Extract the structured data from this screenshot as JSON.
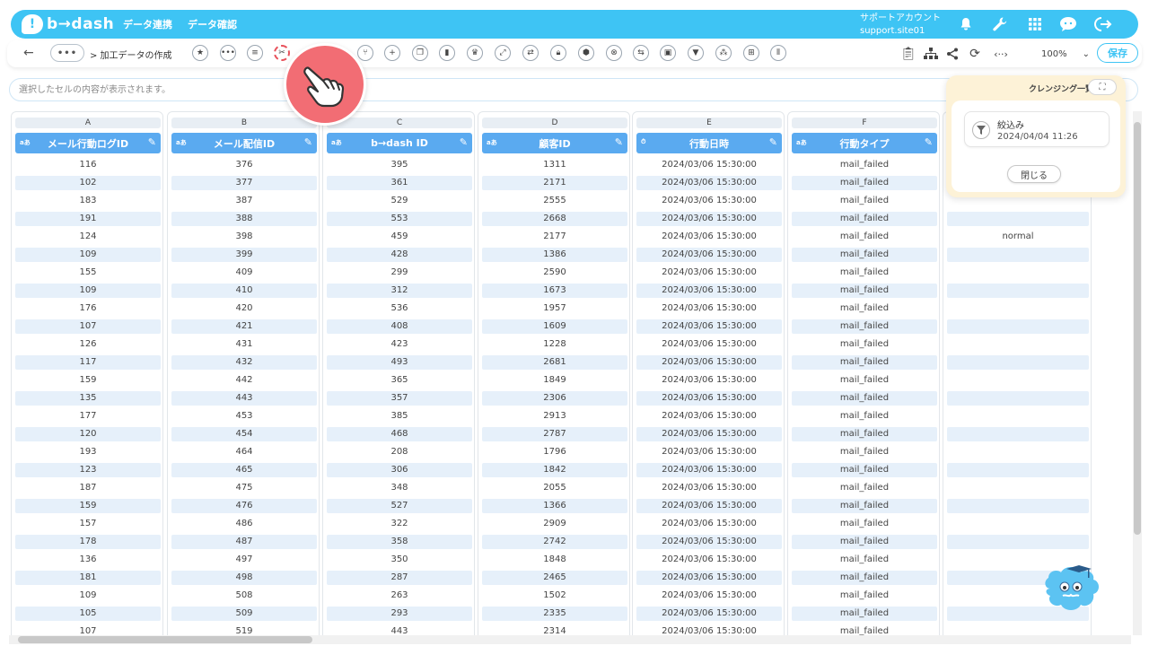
{
  "header": {
    "logo_badge": "!",
    "logo_text": "b→dash",
    "nav": [
      "データ連携",
      "データ確認"
    ],
    "account_name": "サポートアカウント",
    "account_site": "support.site01"
  },
  "toolbar": {
    "back": "←",
    "more": "•••",
    "breadcrumb": "> 加工データの作成",
    "zoom": "100%",
    "save": "保存"
  },
  "cellbar": {
    "placeholder": "選択したセルの内容が表示されます。"
  },
  "columns": [
    {
      "letter": "A",
      "type": "aあ",
      "name": "メール行動ログID",
      "cells": [
        "116",
        "102",
        "183",
        "191",
        "124",
        "109",
        "155",
        "109",
        "176",
        "107",
        "126",
        "117",
        "159",
        "135",
        "177",
        "120",
        "193",
        "123",
        "187",
        "159",
        "157",
        "178",
        "136",
        "181",
        "109",
        "105",
        "107"
      ]
    },
    {
      "letter": "B",
      "type": "aあ",
      "name": "メール配信ID",
      "cells": [
        "376",
        "377",
        "387",
        "388",
        "398",
        "399",
        "409",
        "410",
        "420",
        "421",
        "431",
        "432",
        "442",
        "443",
        "453",
        "454",
        "464",
        "465",
        "475",
        "476",
        "486",
        "487",
        "497",
        "498",
        "508",
        "509",
        "519"
      ]
    },
    {
      "letter": "C",
      "type": "aあ",
      "name": "b→dash ID",
      "cells": [
        "395",
        "361",
        "529",
        "553",
        "459",
        "428",
        "299",
        "312",
        "536",
        "408",
        "423",
        "493",
        "365",
        "357",
        "385",
        "468",
        "208",
        "306",
        "348",
        "527",
        "322",
        "358",
        "350",
        "287",
        "263",
        "293",
        "443"
      ]
    },
    {
      "letter": "D",
      "type": "aあ",
      "name": "顧客ID",
      "cells": [
        "1311",
        "2171",
        "2555",
        "2668",
        "2177",
        "1386",
        "2590",
        "1673",
        "1957",
        "1609",
        "1228",
        "2681",
        "1849",
        "2306",
        "2913",
        "2787",
        "1796",
        "1842",
        "2055",
        "1366",
        "2909",
        "2742",
        "1848",
        "2465",
        "1502",
        "2335",
        "2314"
      ]
    },
    {
      "letter": "E",
      "type": "⏱",
      "name": "行動日時",
      "cells": [
        "2024/03/06 15:30:00",
        "2024/03/06 15:30:00",
        "2024/03/06 15:30:00",
        "2024/03/06 15:30:00",
        "2024/03/06 15:30:00",
        "2024/03/06 15:30:00",
        "2024/03/06 15:30:00",
        "2024/03/06 15:30:00",
        "2024/03/06 15:30:00",
        "2024/03/06 15:30:00",
        "2024/03/06 15:30:00",
        "2024/03/06 15:30:00",
        "2024/03/06 15:30:00",
        "2024/03/06 15:30:00",
        "2024/03/06 15:30:00",
        "2024/03/06 15:30:00",
        "2024/03/06 15:30:00",
        "2024/03/06 15:30:00",
        "2024/03/06 15:30:00",
        "2024/03/06 15:30:00",
        "2024/03/06 15:30:00",
        "2024/03/06 15:30:00",
        "2024/03/06 15:30:00",
        "2024/03/06 15:30:00",
        "2024/03/06 15:30:00",
        "2024/03/06 15:30:00",
        "2024/03/06 15:30:00"
      ]
    },
    {
      "letter": "F",
      "type": "aあ",
      "name": "行動タイプ",
      "cells": [
        "mail_failed",
        "mail_failed",
        "mail_failed",
        "mail_failed",
        "mail_failed",
        "mail_failed",
        "mail_failed",
        "mail_failed",
        "mail_failed",
        "mail_failed",
        "mail_failed",
        "mail_failed",
        "mail_failed",
        "mail_failed",
        "mail_failed",
        "mail_failed",
        "mail_failed",
        "mail_failed",
        "mail_failed",
        "mail_failed",
        "mail_failed",
        "mail_failed",
        "mail_failed",
        "mail_failed",
        "mail_failed",
        "mail_failed",
        "mail_failed"
      ]
    },
    {
      "letter": "",
      "type": "",
      "name": "",
      "cells": [
        "",
        "",
        "",
        "",
        "normal",
        "",
        "",
        "",
        "",
        "",
        "",
        "",
        "",
        "",
        "",
        "",
        "",
        "",
        "",
        "",
        "",
        "",
        "",
        "",
        "",
        "",
        ""
      ]
    }
  ],
  "panel": {
    "title": "クレンジング一覧",
    "expand": "⛶",
    "item_name": "絞込み",
    "item_date": "2024/04/04 11:26",
    "close": "閉じる"
  },
  "colors": {
    "brand": "#3ec4f4",
    "column_header": "#5aaaf0",
    "row_alt": "#e6f0fa",
    "cursor_circle": "#f26d74",
    "panel_bg": "#fdf2d7"
  }
}
